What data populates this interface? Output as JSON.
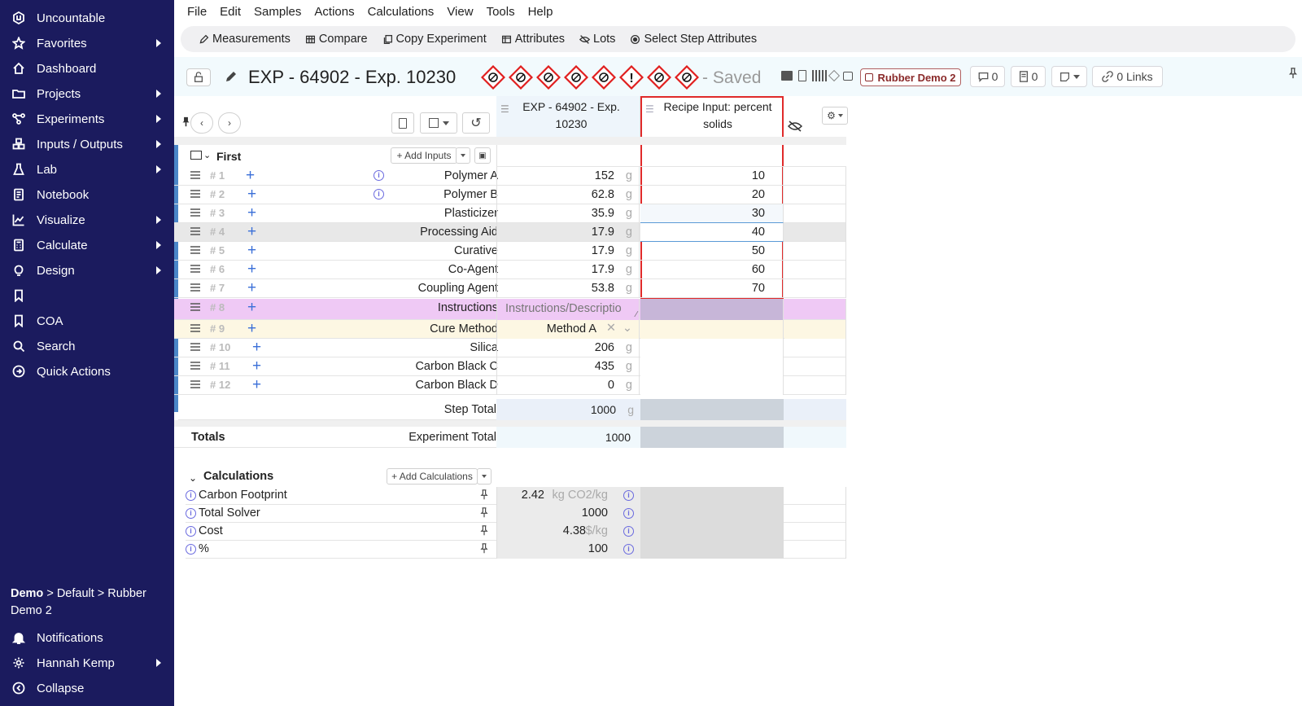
{
  "sidebar": {
    "items": [
      {
        "label": "Uncountable",
        "icon": "hexagon-icon",
        "arrow": false
      },
      {
        "label": "Favorites",
        "icon": "star-icon",
        "arrow": true
      },
      {
        "label": "Dashboard",
        "icon": "home-icon",
        "arrow": false
      },
      {
        "label": "Projects",
        "icon": "folder-icon",
        "arrow": true
      },
      {
        "label": "Experiments",
        "icon": "nodes-icon",
        "arrow": true
      },
      {
        "label": "Inputs / Outputs",
        "icon": "cubes-icon",
        "arrow": true
      },
      {
        "label": "Lab",
        "icon": "flask-icon",
        "arrow": true
      },
      {
        "label": "Notebook",
        "icon": "notebook-icon",
        "arrow": false
      },
      {
        "label": "Visualize",
        "icon": "chart-icon",
        "arrow": true
      },
      {
        "label": "Calculate",
        "icon": "calculator-icon",
        "arrow": true
      },
      {
        "label": "Design",
        "icon": "bulb-icon",
        "arrow": true
      },
      {
        "label": "",
        "icon": "bookmark-icon",
        "arrow": false
      },
      {
        "label": "COA",
        "icon": "bookmark-icon",
        "arrow": false
      },
      {
        "label": "Search",
        "icon": "search-icon",
        "arrow": false
      },
      {
        "label": "Quick Actions",
        "icon": "circle-arrow-icon",
        "arrow": false
      }
    ],
    "breadcrumb_bold": "Demo",
    "breadcrumb_rest": " > Default > Rubber Demo 2",
    "bottom": [
      {
        "label": "Notifications",
        "icon": "bell-icon",
        "arrow": false
      },
      {
        "label": "Hannah Kemp",
        "icon": "gear-icon",
        "arrow": true
      },
      {
        "label": "Collapse",
        "icon": "circle-left-icon",
        "arrow": false
      }
    ]
  },
  "menu": [
    "File",
    "Edit",
    "Samples",
    "Actions",
    "Calculations",
    "View",
    "Tools",
    "Help"
  ],
  "toolbar": [
    "Measurements",
    "Compare",
    "Copy Experiment",
    "Attributes",
    "Lots",
    "Select Step Attributes"
  ],
  "header": {
    "title": "EXP - 64902 - Exp. 10230",
    "saved": "- Saved",
    "project_badge": "Rubber Demo 2",
    "comments": "0",
    "notes": "0",
    "links": "0 Links"
  },
  "columns": {
    "col1": "EXP - 64902 - Exp. 10230",
    "col2": "Recipe Input: percent solids"
  },
  "step": {
    "name": "First",
    "add_inputs": "+ Add Inputs",
    "rows": [
      {
        "num": "# 1",
        "name": "Polymer A",
        "info": true,
        "v1": "152",
        "unit": "g",
        "v2": "10"
      },
      {
        "num": "# 2",
        "name": "Polymer B",
        "info": true,
        "v1": "62.8",
        "unit": "g",
        "v2": "20"
      },
      {
        "num": "# 3",
        "name": "Plasticizer",
        "info": false,
        "v1": "35.9",
        "unit": "g",
        "v2": "30"
      },
      {
        "num": "# 4",
        "name": "Processing Aid",
        "info": false,
        "v1": "17.9",
        "unit": "g",
        "v2": "40"
      },
      {
        "num": "# 5",
        "name": "Curative",
        "info": false,
        "v1": "17.9",
        "unit": "g",
        "v2": "50"
      },
      {
        "num": "# 6",
        "name": "Co-Agent",
        "info": false,
        "v1": "17.9",
        "unit": "g",
        "v2": "60"
      },
      {
        "num": "# 7",
        "name": "Coupling Agent",
        "info": false,
        "v1": "53.8",
        "unit": "g",
        "v2": "70"
      },
      {
        "num": "# 8",
        "name": "Instructions",
        "info": false,
        "v1": "Instructions/Descriptio",
        "unit": "",
        "v2": ""
      },
      {
        "num": "# 9",
        "name": "Cure Method",
        "info": false,
        "v1": "Method A",
        "unit": "",
        "v2": ""
      },
      {
        "num": "# 10",
        "name": "Silica",
        "info": false,
        "v1": "206",
        "unit": "g",
        "v2": ""
      },
      {
        "num": "# 11",
        "name": "Carbon Black C",
        "info": false,
        "v1": "435",
        "unit": "g",
        "v2": ""
      },
      {
        "num": "# 12",
        "name": "Carbon Black D",
        "info": false,
        "v1": "0",
        "unit": "g",
        "v2": ""
      }
    ],
    "step_total_label": "Step Total",
    "step_total": "1000",
    "step_total_unit": "g"
  },
  "totals": {
    "label": "Totals",
    "exp_total_label": "Experiment Total",
    "exp_total": "1000"
  },
  "calculations": {
    "title": "Calculations",
    "add": "+ Add Calculations",
    "rows": [
      {
        "name": "Carbon Footprint",
        "value": "2.42",
        "unit": "kg CO2/kg"
      },
      {
        "name": "Total Solver",
        "value": "1000",
        "unit": ""
      },
      {
        "name": "Cost",
        "value": "4.38",
        "unit": "$/kg"
      },
      {
        "name": "%",
        "value": "100",
        "unit": ""
      }
    ]
  }
}
